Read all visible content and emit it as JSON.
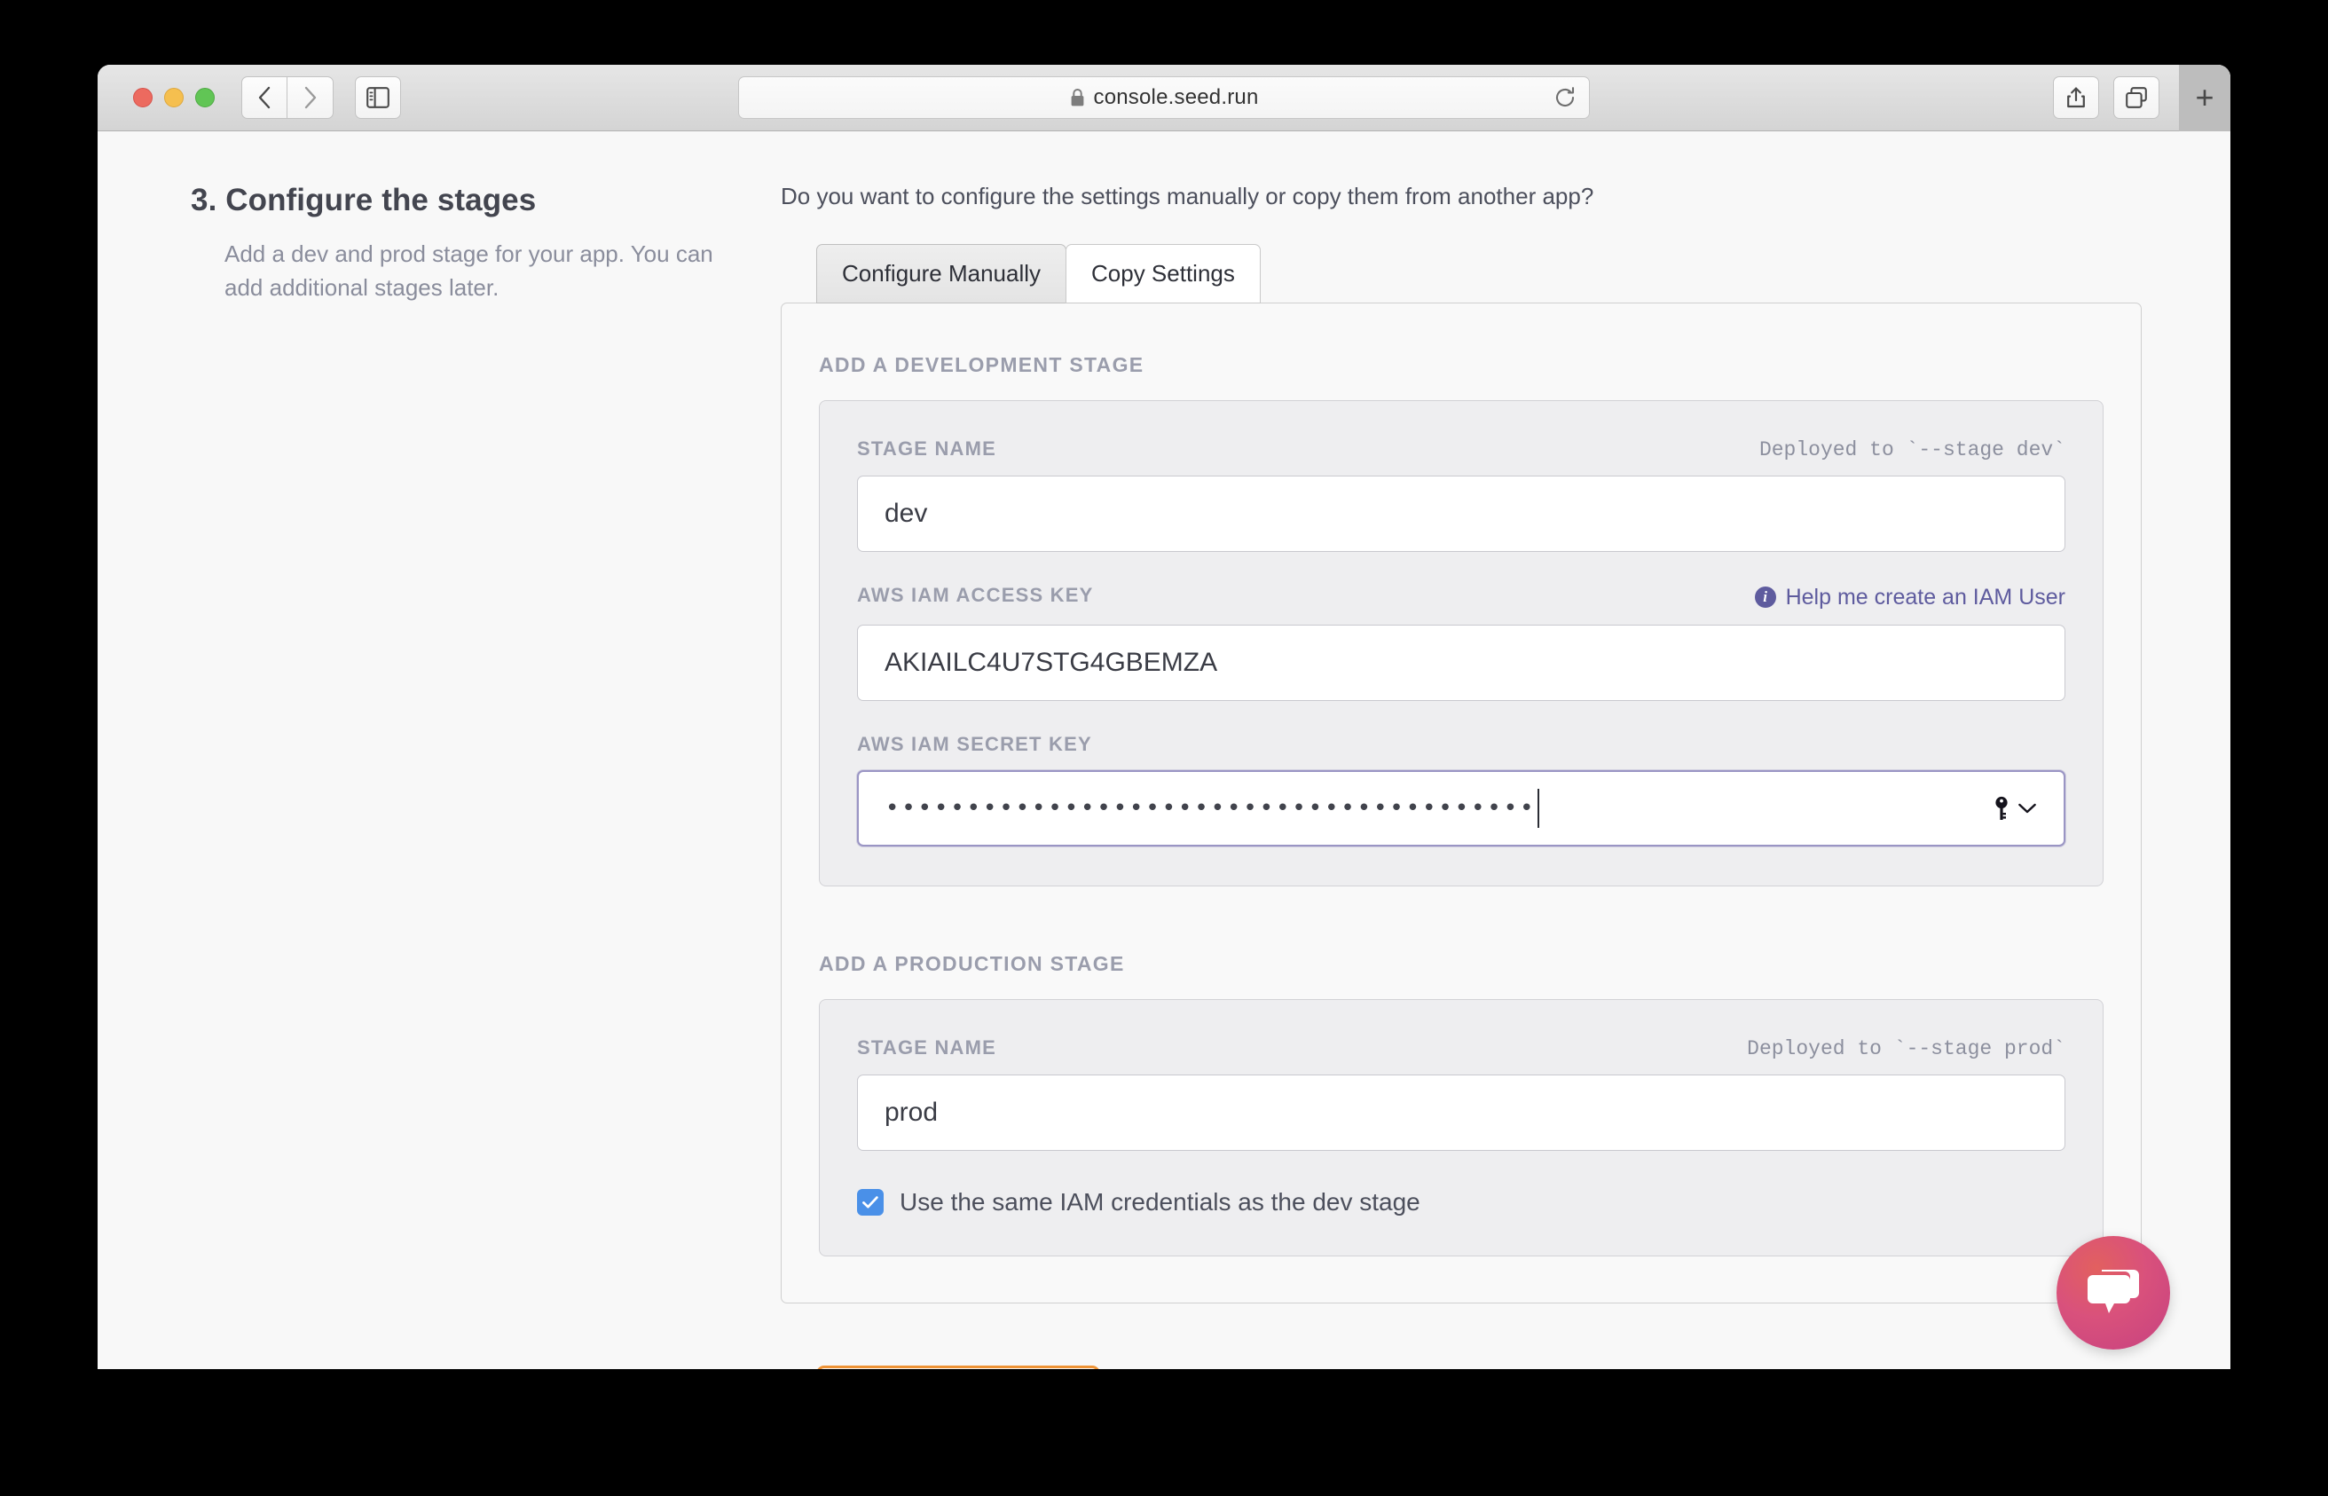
{
  "browser": {
    "url": "console.seed.run",
    "lock_icon": "lock-icon",
    "reload_icon": "reload-icon",
    "back_icon": "chevron-left-icon",
    "forward_icon": "chevron-right-icon",
    "sidebar_icon": "sidebar-toggle-icon",
    "share_icon": "share-icon",
    "tabs_icon": "tab-overview-icon",
    "new_tab_label": "+",
    "traffic_lights": [
      "close",
      "minimize",
      "zoom"
    ]
  },
  "step": {
    "title": "3. Configure the stages",
    "description": "Add a dev and prod stage for your app. You can add additional stages later."
  },
  "main": {
    "question": "Do you want to configure the settings manually or copy them from another app?",
    "tabs": [
      {
        "label": "Configure Manually",
        "active": true
      },
      {
        "label": "Copy Settings",
        "active": false
      }
    ],
    "dev_section": {
      "heading": "ADD A DEVELOPMENT STAGE",
      "stage_name_label": "STAGE NAME",
      "stage_name_hint": "Deployed to `--stage dev`",
      "stage_name_value": "dev",
      "access_key_label": "AWS IAM ACCESS KEY",
      "help_link": "Help me create an IAM User",
      "help_icon": "info-icon",
      "access_key_value": "AKIAILC4U7STG4GBEMZA",
      "secret_key_label": "AWS IAM SECRET KEY",
      "secret_key_masked": "••••••••••••••••••••••••••••••••••••••••",
      "autofill_icon": "key-icon",
      "autofill_chevron": "chevron-down-icon"
    },
    "prod_section": {
      "heading": "ADD A PRODUCTION STAGE",
      "stage_name_label": "STAGE NAME",
      "stage_name_hint": "Deployed to `--stage prod`",
      "stage_name_value": "prod",
      "checkbox_label": "Use the same IAM credentials as the dev stage",
      "checkbox_checked": true
    }
  },
  "chat": {
    "icon": "chat-bubbles-icon"
  },
  "colors": {
    "accent_purple": "#5e5b9e",
    "checkbox_blue": "#4a90e8",
    "submit_orange": "#ee9336",
    "chat_pink": "#d9517c",
    "page_bg": "#f8f8f8"
  }
}
